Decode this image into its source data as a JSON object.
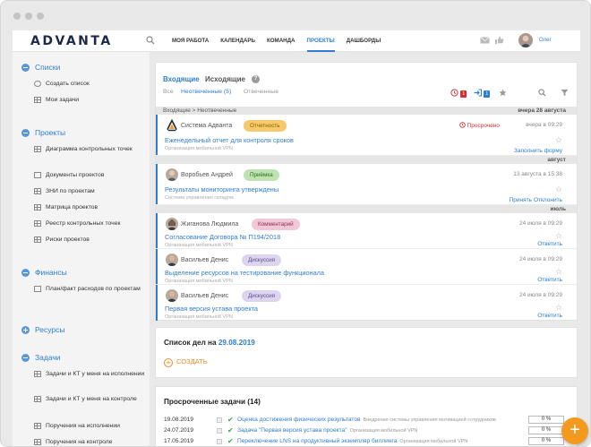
{
  "header": {
    "logo": "ADVANTA",
    "nav": [
      "МОЯ РАБОТА",
      "КАЛЕНДАРЬ",
      "КОМАНДА",
      "ПРОЕКТЫ",
      "ДАШБОРДЫ"
    ],
    "active_nav": "ПРОЕКТЫ",
    "user_name": "Олег"
  },
  "sidebar": {
    "sections": [
      {
        "label": "Списки",
        "items": [
          "Создать список",
          "Мои задачи"
        ]
      },
      {
        "label": "Проекты",
        "items": [
          "Диаграмма контрольных точек",
          "Документы проектов",
          "ЗНИ по проектам",
          "Матрица проектов",
          "Реестр контрольных точек",
          "Риски проектов"
        ]
      },
      {
        "label": "Финансы",
        "items": [
          "План/факт расходов по проектам"
        ]
      },
      {
        "label": "Ресурсы",
        "items": []
      },
      {
        "label": "Задачи",
        "items": [
          "Задачи и КТ у меня на исполнении",
          "Задачи и КТ у меня на контроле",
          "Поручения на исполнении",
          "Поручения на контроле"
        ]
      }
    ]
  },
  "inbox": {
    "tab_incoming": "Входящие",
    "tab_outgoing": "Исходящие",
    "filter_all": "Все",
    "filter_unanswered": "Неотвеченные",
    "filter_unanswered_count": "(5)",
    "filter_answered": "Отвеченные",
    "badge_red": "1",
    "badge_blue": "1",
    "breadcrumb": "Входящие  >  Неотвеченные",
    "groups": [
      {
        "label": "вчера 28 августа",
        "items": [
          {
            "sender": "Система Адванта",
            "tag": "Отчетность",
            "overdue": "Просрочено",
            "date": "вчера в 09:29",
            "title": "Еженедельный отчет для контроля сроков",
            "org": "Организация мобильной VPN",
            "actions": [
              "Заполнить форму"
            ]
          }
        ]
      },
      {
        "label": "август",
        "items": [
          {
            "sender": "Воробьев Андрей",
            "tag": "Приёмка",
            "date": "13 августа в 15:38",
            "title": "Результаты мониторинга утверждены",
            "org": "Система управления складом",
            "actions": [
              "Принять",
              "Отклонить"
            ]
          }
        ]
      },
      {
        "label": "июль",
        "items": [
          {
            "sender": "Жиганова Людмила",
            "tag": "Комментарий",
            "date": "24 июля в 09:29",
            "title": "Согласование Договора № П194/2018",
            "org": "Организация мобильной VPN",
            "actions": [
              "Ответить"
            ]
          },
          {
            "sender": "Васильев Денис",
            "tag": "Дискуссия",
            "date": "24 июля в 09:29",
            "title": "Выделение ресурсов на тестирование функционала",
            "org": "Организация мобильной VPN",
            "actions": [
              "Ответить"
            ]
          },
          {
            "sender": "Васильев Денис",
            "tag": "Дискуссия",
            "date": "24 июля в 09:29",
            "title": "Первая версия устава проекта",
            "org": "Организация мобильной VPN",
            "actions": [
              "Ответить"
            ]
          }
        ]
      }
    ]
  },
  "todo": {
    "title_prefix": "Список дел на",
    "date": "29.08.2019",
    "create_label": "СОЗДАТЬ"
  },
  "overdue": {
    "title": "Просроченные задачи (14)",
    "rows": [
      {
        "date": "19.08.2019",
        "title": "Оценка достижения физических результатов",
        "org": "Внедрение системы управления мотивацией сотрудников",
        "pct": "0 %"
      },
      {
        "date": "24.07.2019",
        "title": "Задача \"Первая версия устава проекта\"",
        "org": "Организация мобильной VPN",
        "pct": "0 %"
      },
      {
        "date": "17.05.2019",
        "title": "Переключение LNS на продуктивный экземпляр биллинга",
        "org": "Организация мобильной VPN",
        "pct": "0 %"
      }
    ]
  },
  "colors": {
    "accent": "#2f7dd1",
    "orange": "#f39a1e",
    "tag_report": "#f6c96a",
    "tag_accept": "#bfe3b0",
    "tag_comment": "#f2c7d8",
    "tag_discussion": "#ddd5f0"
  }
}
